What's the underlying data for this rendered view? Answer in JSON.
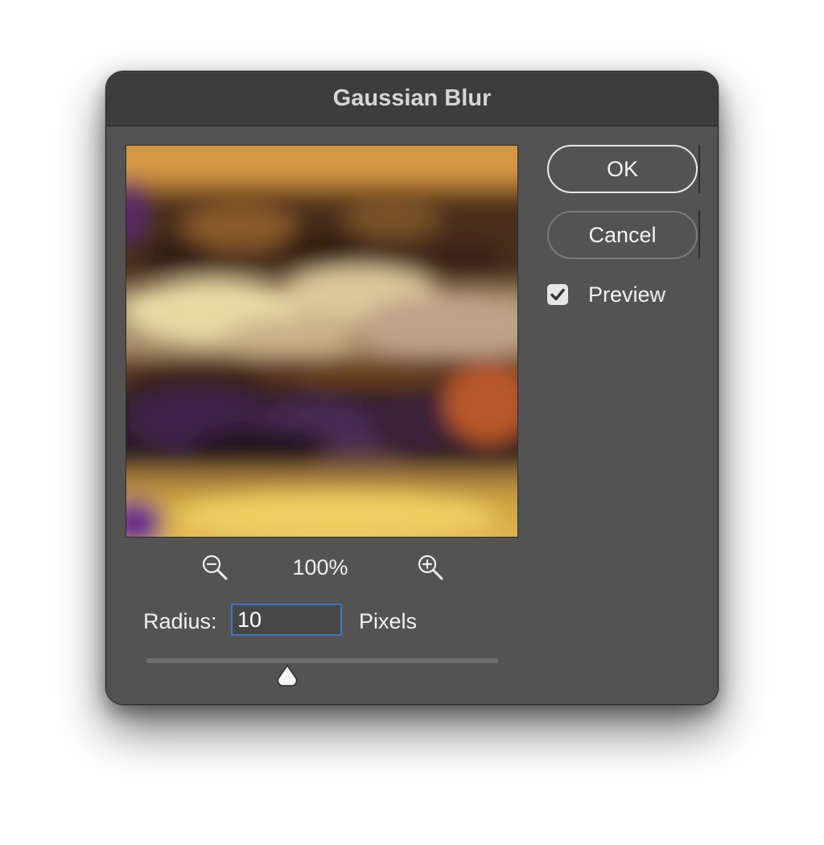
{
  "dialog": {
    "title": "Gaussian Blur"
  },
  "buttons": {
    "ok_label": "OK",
    "cancel_label": "Cancel"
  },
  "preview_option": {
    "label": "Preview",
    "checked": true
  },
  "zoom": {
    "level": "100%",
    "zoom_out_icon": "zoom-out-magnifier-icon",
    "zoom_in_icon": "zoom-in-magnifier-icon"
  },
  "radius": {
    "label": "Radius:",
    "value": "10",
    "units": "Pixels",
    "slider_fraction": 0.4
  },
  "colors": {
    "dialog_bg": "#535353",
    "titlebar_bg": "#3d3d3d",
    "input_focus_border": "#3e74c8"
  }
}
